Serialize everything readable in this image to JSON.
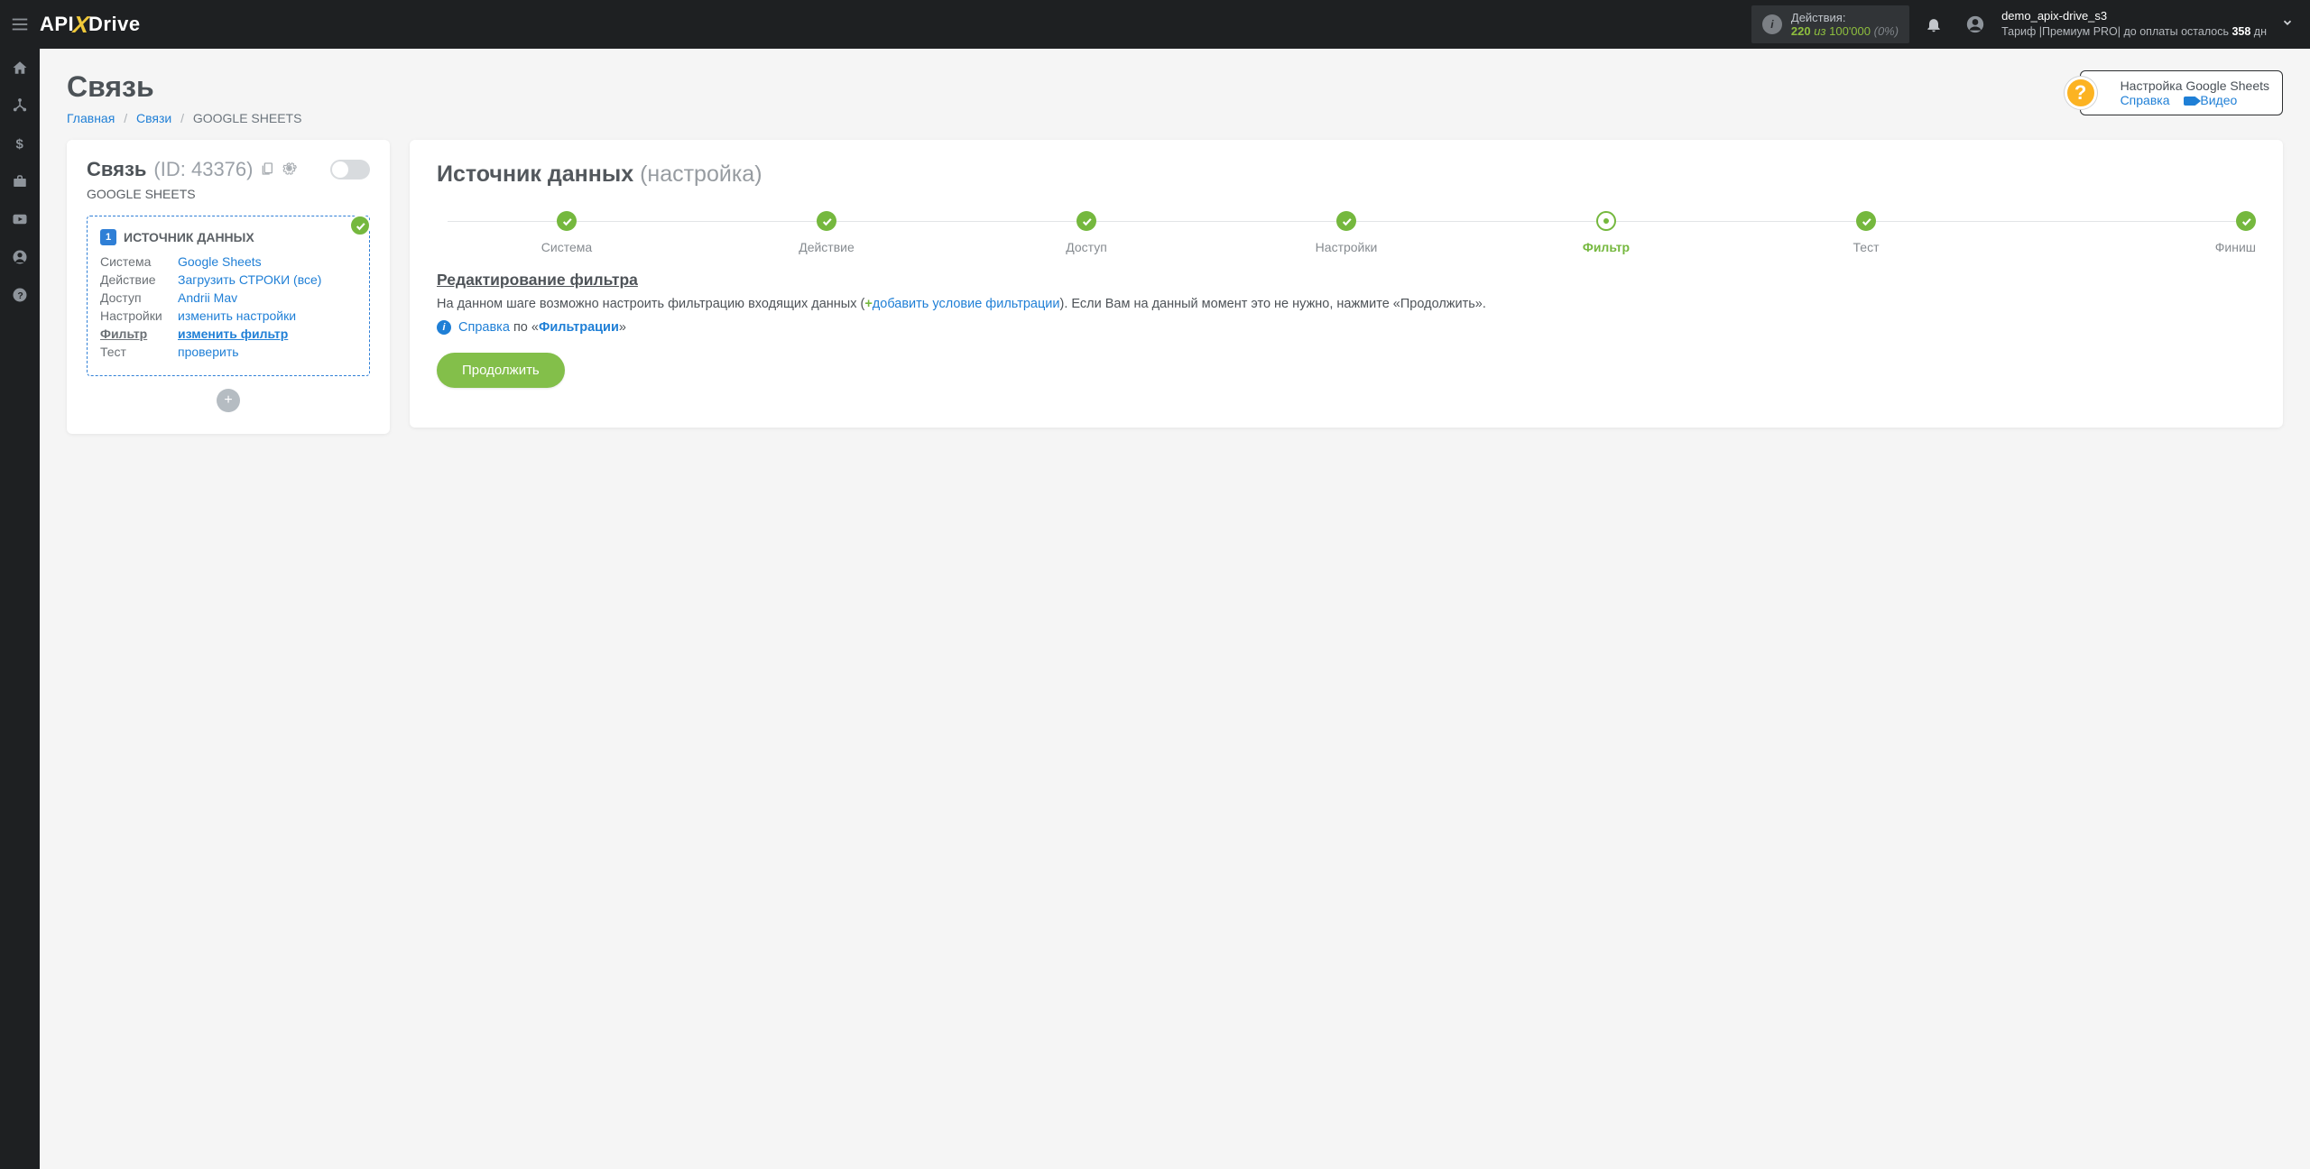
{
  "topbar": {
    "logo_api": "API",
    "logo_drive": "Drive",
    "actions_label": "Действия:",
    "actions_count": "220",
    "actions_of": "из",
    "actions_limit": "100'000",
    "actions_pct": "(0%)",
    "user_name": "demo_apix-drive_s3",
    "tariff_pre": "Тариф |",
    "tariff_name": "Премиум PRO",
    "tariff_mid": "|  до оплаты осталось ",
    "days_left": "358",
    "days_unit": " дн"
  },
  "page": {
    "title": "Связь",
    "breadcrumb": {
      "home": "Главная",
      "connections": "Связи",
      "active": "GOOGLE SHEETS"
    }
  },
  "help_box": {
    "title": "Настройка Google Sheets",
    "help_link": "Справка",
    "video_link": "Видео"
  },
  "connection": {
    "title": "Связь",
    "id_label": "(ID: 43376)",
    "subtitle": "GOOGLE SHEETS",
    "source_box": {
      "title": "ИСТОЧНИК ДАННЫХ",
      "rows": [
        {
          "label": "Система",
          "value": "Google Sheets"
        },
        {
          "label": "Действие",
          "value": "Загрузить СТРОКИ (все)"
        },
        {
          "label": "Доступ",
          "value": "Andrii Mav"
        },
        {
          "label": "Настройки",
          "value": "изменить настройки"
        },
        {
          "label": "Фильтр",
          "value": "изменить фильтр"
        },
        {
          "label": "Тест",
          "value": "проверить"
        }
      ]
    }
  },
  "main": {
    "title": "Источник данных",
    "title_sub": "(настройка)",
    "steps": [
      {
        "label": "Система",
        "state": "done"
      },
      {
        "label": "Действие",
        "state": "done"
      },
      {
        "label": "Доступ",
        "state": "done"
      },
      {
        "label": "Настройки",
        "state": "done"
      },
      {
        "label": "Фильтр",
        "state": "current"
      },
      {
        "label": "Тест",
        "state": "done"
      },
      {
        "label": "Финиш",
        "state": "done"
      }
    ],
    "section_title": "Редактирование фильтра",
    "desc_pre": "На данном шаге возможно настроить фильтрацию входящих данных (",
    "desc_plus": "+",
    "desc_link": "добавить условие фильтрации",
    "desc_post": "). Если Вам на данный момент это не нужно, нажмите «Продолжить».",
    "help_pre": "Справка",
    "help_mid": " по «",
    "help_link": "Фильтрации",
    "help_post": "»",
    "continue_btn": "Продолжить"
  }
}
